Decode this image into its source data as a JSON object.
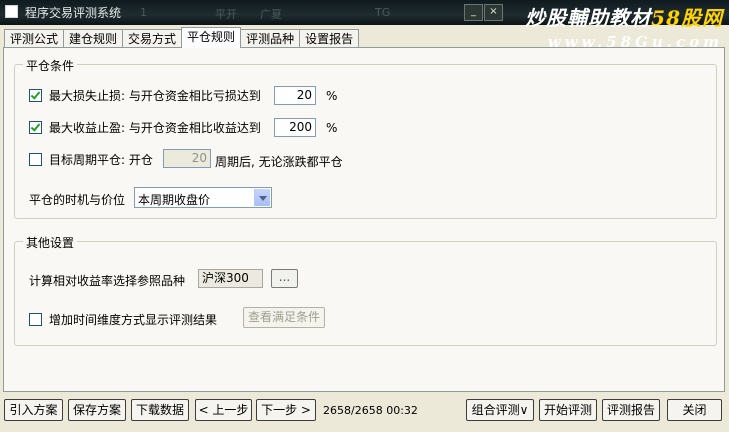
{
  "window": {
    "title": "程序交易评测系统",
    "ghost_text": [
      "1",
      "平开",
      "",
      "广夏",
      "",
      "TG"
    ],
    "buttons": {
      "minimize": "_",
      "close": "×"
    }
  },
  "watermark": {
    "title_main": "炒股輔助教材",
    "title_hl": "58股网",
    "url": "www.58Gu.com"
  },
  "tabs": [
    "评测公式",
    "建仓规则",
    "交易方式",
    "平仓规则",
    "评测品种",
    "设置报告"
  ],
  "active_tab": 3,
  "close_conditions": {
    "title": "平仓条件",
    "stop_loss": {
      "checked": true,
      "label": "最大损失止损:  与开仓资金相比亏损达到",
      "value": "20",
      "unit": "%"
    },
    "take_profit": {
      "checked": true,
      "label": "最大收益止盈:  与开仓资金相比收益达到",
      "value": "200",
      "unit": "%"
    },
    "target_period": {
      "checked": false,
      "label": "目标周期平仓:  开仓",
      "value": "20",
      "suffix": "周期后, 无论涨跌都平仓"
    },
    "timing": {
      "label": "平仓的时机与价位",
      "selected": "本周期收盘价"
    }
  },
  "other_settings": {
    "title": "其他设置",
    "benchmark": {
      "label": "计算相对收益率选择参照品种",
      "value": "沪深300",
      "button": "..."
    },
    "time_dimension": {
      "checked": false,
      "label": "增加时间维度方式显示评测结果",
      "button": "查看满足条件"
    }
  },
  "bottom_bar": {
    "import": "引入方案",
    "save": "保存方案",
    "download": "下载数据",
    "prev": "< 上一步",
    "next": "下一步 >",
    "status": "2658/2658 00:32",
    "combo": "组合评测∨",
    "start": "开始评测",
    "report": "评测报告",
    "close": "关闭"
  },
  "colors": {
    "title_bar": "#1f2c30",
    "watermark_highlight": "#ffd400",
    "checkmark": "#21a121"
  }
}
